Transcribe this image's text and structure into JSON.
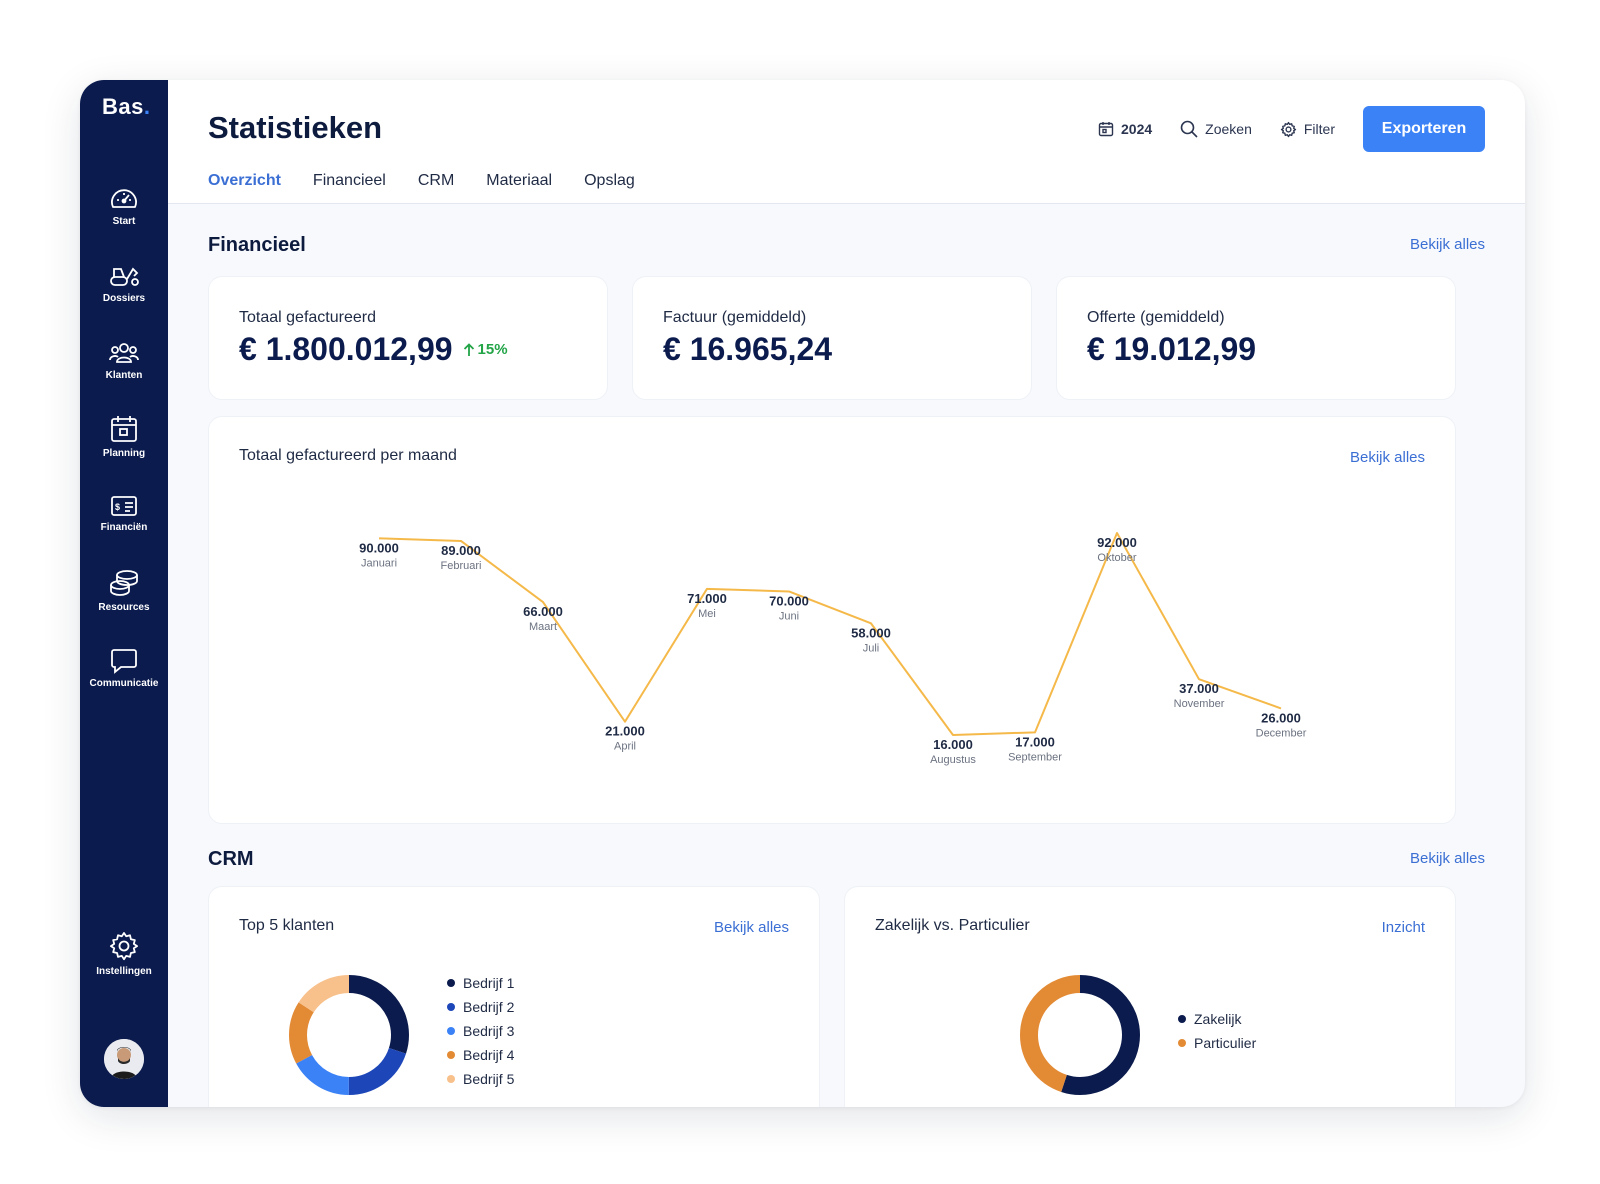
{
  "app": {
    "logo": "Bas",
    "logo_dot": "."
  },
  "sidebar": {
    "items": [
      {
        "label": "Start",
        "icon": "speedometer-icon"
      },
      {
        "label": "Dossiers",
        "icon": "machinery-icon"
      },
      {
        "label": "Klanten",
        "icon": "users-icon"
      },
      {
        "label": "Planning",
        "icon": "calendar-icon"
      },
      {
        "label": "Financiën",
        "icon": "bill-icon"
      },
      {
        "label": "Resources",
        "icon": "coins-icon"
      },
      {
        "label": "Communicatie",
        "icon": "chat-icon"
      }
    ],
    "settings": {
      "label": "Instellingen",
      "icon": "gear-icon"
    }
  },
  "header": {
    "title": "Statistieken",
    "year": "2024",
    "search_label": "Zoeken",
    "filter_label": "Filter",
    "export_label": "Exporteren",
    "tabs": [
      "Overzicht",
      "Financieel",
      "CRM",
      "Materiaal",
      "Opslag"
    ],
    "active_tab": 0
  },
  "financieel": {
    "title": "Financieel",
    "link": "Bekijk alles",
    "kpis": [
      {
        "label": "Totaal gefactureerd",
        "value": "€ 1.800.012,99",
        "delta": "15%"
      },
      {
        "label": "Factuur (gemiddeld)",
        "value": "€ 16.965,24"
      },
      {
        "label": "Offerte (gemiddeld)",
        "value": "€ 19.012,99"
      }
    ]
  },
  "monthly": {
    "title": "Totaal gefactureerd per maand",
    "link": "Bekijk alles"
  },
  "chart_data": [
    {
      "type": "line",
      "title": "Totaal gefactureerd per maand",
      "categories": [
        "Januari",
        "Februari",
        "Maart",
        "April",
        "Mei",
        "Juni",
        "Juli",
        "Augustus",
        "September",
        "Oktober",
        "November",
        "December"
      ],
      "values": [
        90000,
        89000,
        66000,
        21000,
        71000,
        70000,
        58000,
        16000,
        17000,
        92000,
        37000,
        26000
      ],
      "value_labels": [
        "90.000",
        "89.000",
        "66.000",
        "21.000",
        "71.000",
        "70.000",
        "58.000",
        "16.000",
        "17.000",
        "92.000",
        "37.000",
        "26.000"
      ],
      "color": "#f5b94a",
      "grid": false
    },
    {
      "type": "pie",
      "title": "Top 5 klanten",
      "categories": [
        "Bedrijf 1",
        "Bedrijf 2",
        "Bedrijf 3",
        "Bedrijf 4",
        "Bedrijf 5"
      ],
      "values": [
        30,
        20,
        17,
        17,
        16
      ],
      "colors": [
        "#0b1b4d",
        "#1d46b8",
        "#3b82f6",
        "#e38a34",
        "#f8c08a"
      ]
    },
    {
      "type": "pie",
      "title": "Zakelijk vs. Particulier",
      "categories": [
        "Zakelijk",
        "Particulier"
      ],
      "values": [
        55,
        45
      ],
      "colors": [
        "#0b1b4d",
        "#e38a34"
      ]
    }
  ],
  "crm": {
    "title": "CRM",
    "link": "Bekijk alles",
    "top5": {
      "title": "Top 5 klanten",
      "link": "Bekijk alles"
    },
    "split": {
      "title": "Zakelijk vs. Particulier",
      "link": "Inzicht"
    }
  }
}
